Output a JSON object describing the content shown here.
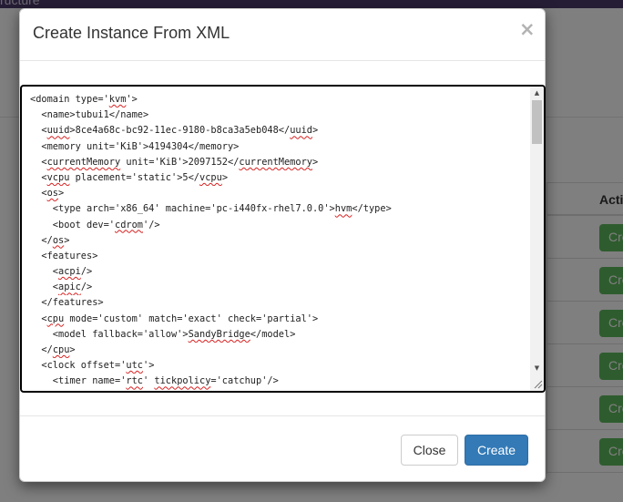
{
  "background": {
    "topbar_text": "ructure",
    "table_header": "Acti",
    "row_button_label": "Cre"
  },
  "modal": {
    "title": "Create Instance From XML",
    "close_symbol": "×",
    "buttons": {
      "close_label": "Close",
      "create_label": "Create"
    },
    "colors": {
      "primary": "#337ab7",
      "success": "#5cb85c",
      "topbar": "#4a3a6a"
    }
  },
  "editor": {
    "lines": [
      "<domain type='kvm'>",
      "  <name>tubui1</name>",
      "  <uuid>8ce4a68c-bc92-11ec-9180-b8ca3a5eb048</uuid>",
      "  <memory unit='KiB'>4194304</memory>",
      "  <currentMemory unit='KiB'>2097152</currentMemory>",
      "  <vcpu placement='static'>5</vcpu>",
      "  <os>",
      "    <type arch='x86_64' machine='pc-i440fx-rhel7.0.0'>hvm</type>",
      "    <boot dev='cdrom'/>",
      "  </os>",
      "  <features>",
      "    <acpi/>",
      "    <apic/>",
      "  </features>",
      "  <cpu mode='custom' match='exact' check='partial'>",
      "    <model fallback='allow'>SandyBridge</model>",
      "  </cpu>",
      "  <clock offset='utc'>",
      "    <timer name='rtc' tickpolicy='catchup'/>"
    ],
    "spellcheck_words": [
      "kvm",
      "uuid",
      "currentMemory",
      "vcpu",
      "os",
      "hvm",
      "cdrom",
      "acpi",
      "apic",
      "cpu",
      "SandyBridge",
      "utc",
      "rtc",
      "tickpolicy"
    ]
  }
}
